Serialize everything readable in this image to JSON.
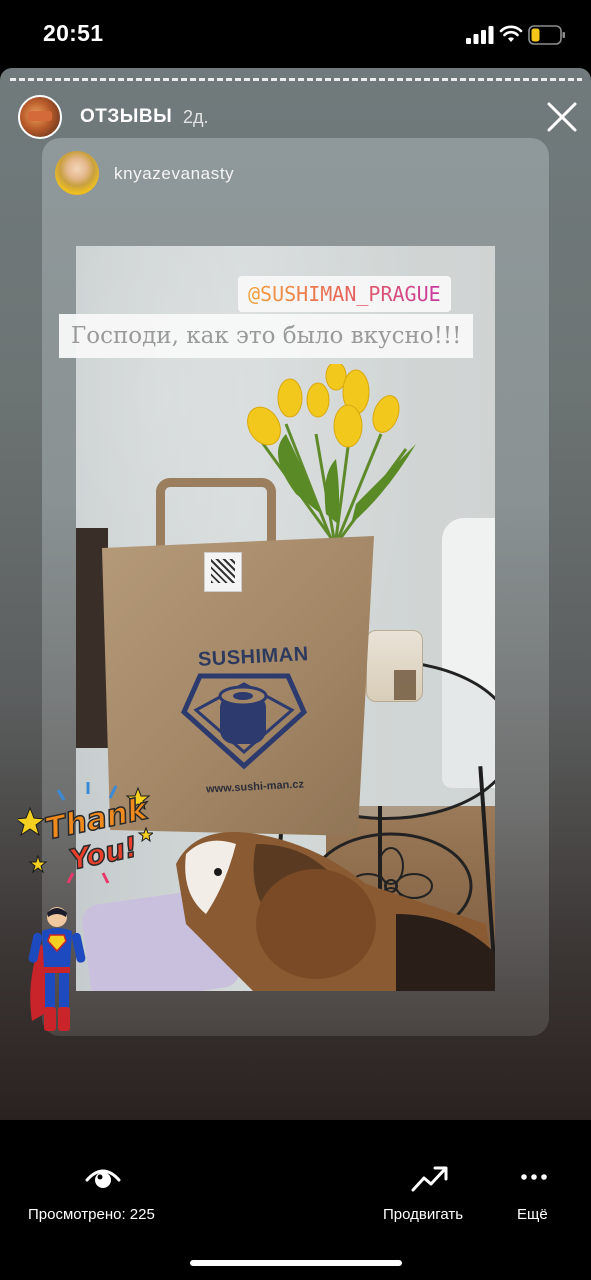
{
  "status_bar": {
    "time": "20:51",
    "signal_icon": "cellular-signal-icon",
    "wifi_icon": "wifi-icon",
    "battery_icon": "battery-low-icon",
    "battery_color": "#f5c518"
  },
  "story": {
    "account_name": "ОТЗЫВЫ",
    "age": "2д.",
    "close_icon": "close-icon",
    "reshared_post": {
      "username": "knyazevanasty",
      "mention": "@SUSHIMAN_PRAGUE",
      "caption": "Господи, как это было вкусно!!!",
      "bag_brand": "SUSHIMAN",
      "bag_url": "www.sushi-man.cz"
    },
    "stickers": [
      "thank-you-sticker",
      "superman-sticker"
    ]
  },
  "footer": {
    "views_label": "Просмотрено: 225",
    "promote_label": "Продвигать",
    "more_label": "Ещё"
  }
}
